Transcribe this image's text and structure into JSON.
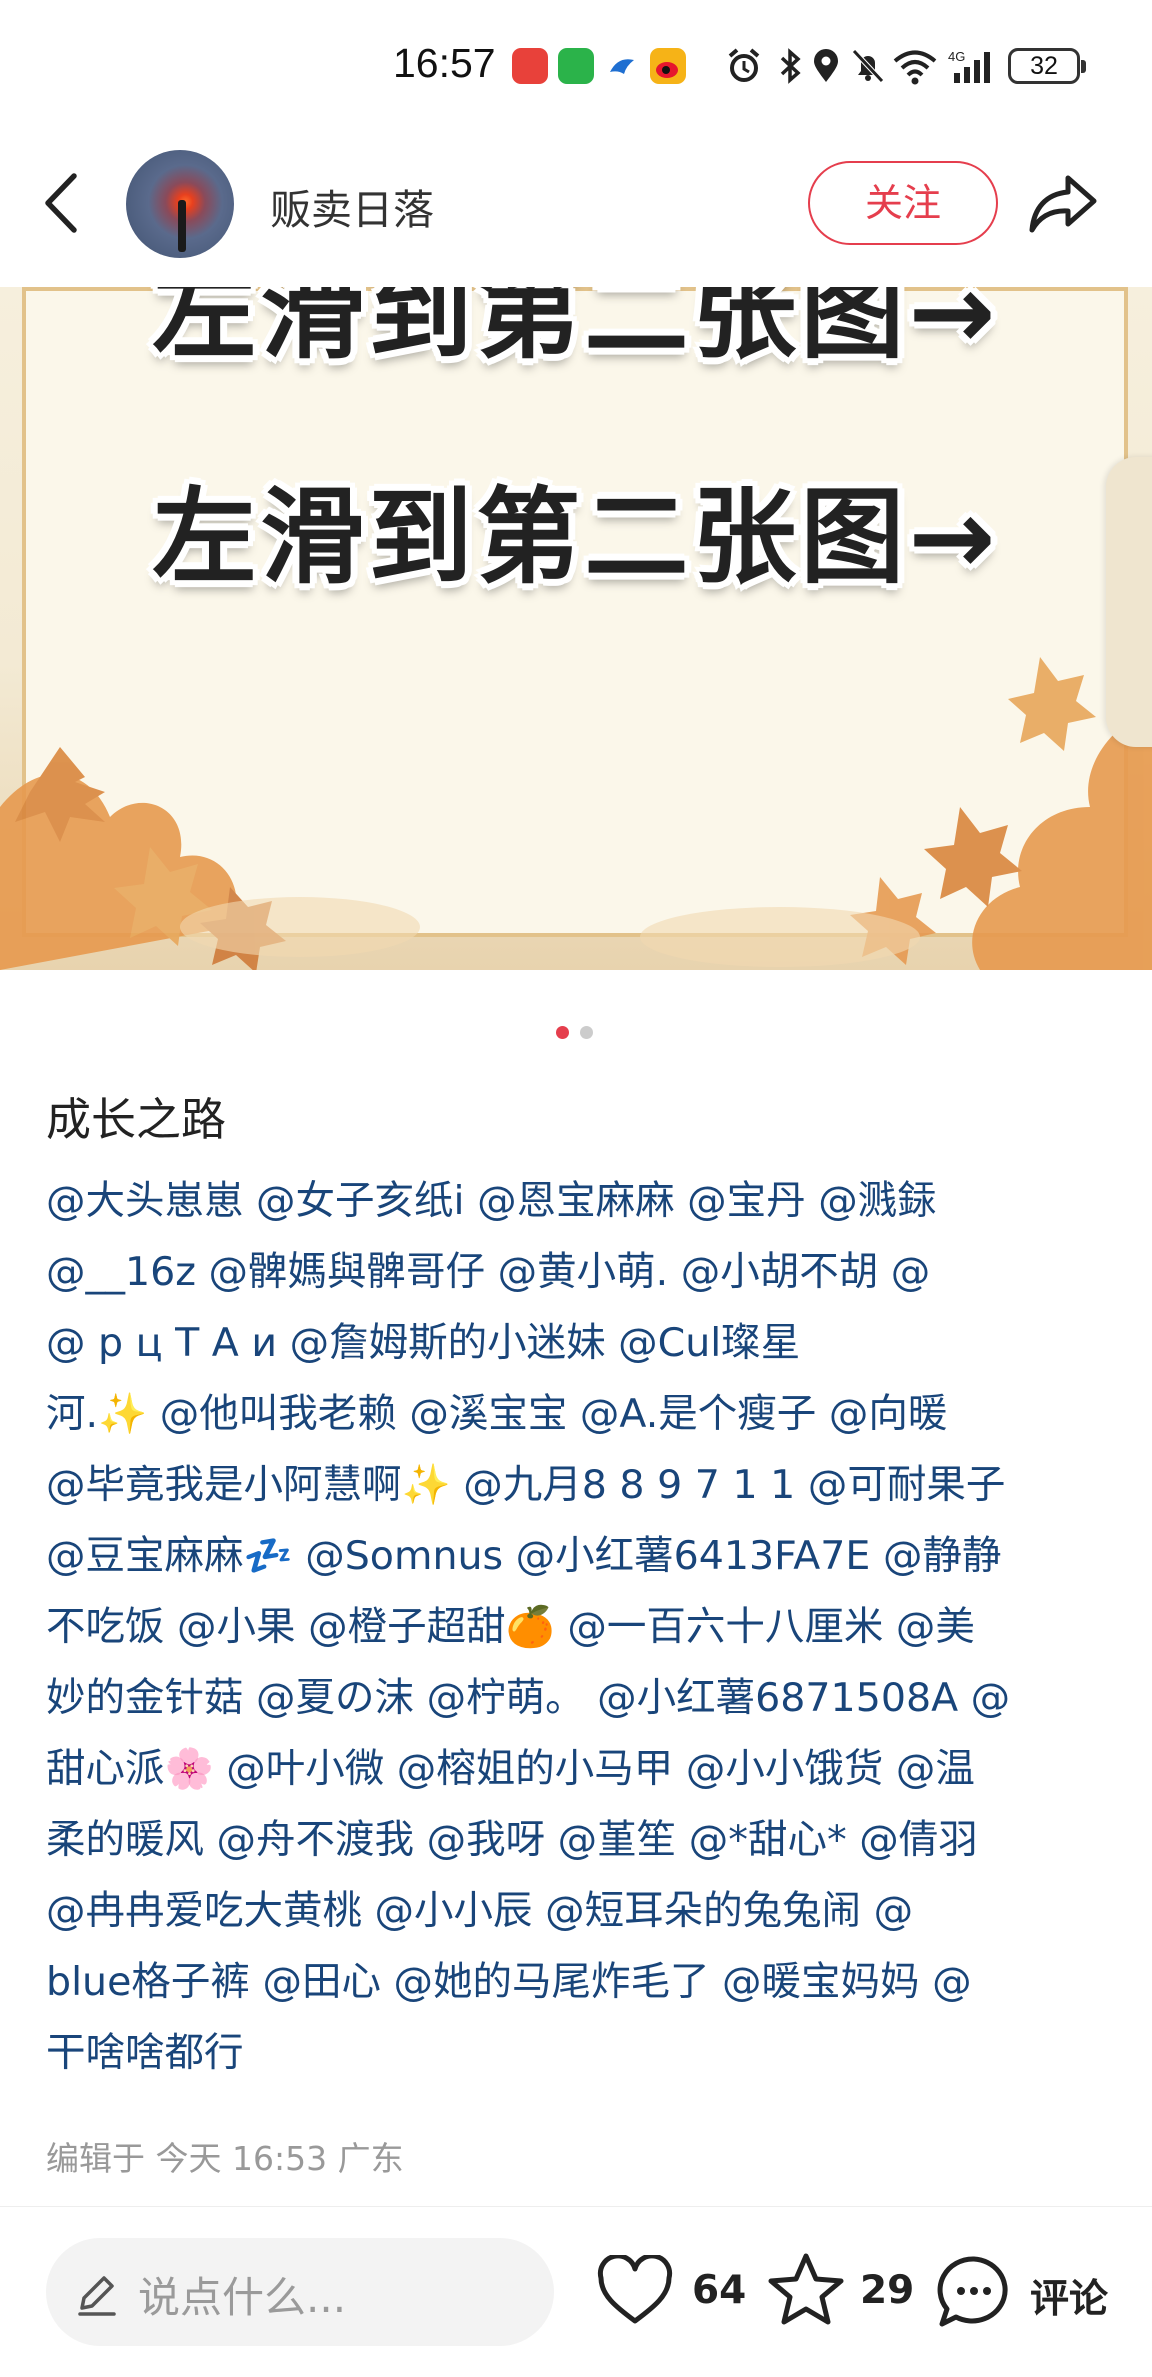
{
  "status_bar": {
    "time": "16:57",
    "battery": "32",
    "network": "4G"
  },
  "header": {
    "author_name": "贩卖日落",
    "follow_label": "关注"
  },
  "image": {
    "cover_text": "左滑到第二张图→",
    "current_page": 1,
    "total_pages": 2,
    "active_dot_color": "#e53e4d",
    "inactive_dot_color": "#cccccc"
  },
  "post": {
    "title": "成长之路",
    "body": "@大头崽崽 @女子亥纸i @恩宝麻麻 @宝丹 @溅銾\n@__16z @髀媽與髀哥仔 @黄小萌. @小胡不胡 @\n        @ p ц Т А и  @詹姆斯的小迷妹 @Cul璨星\n河.✨ @他叫我老赖 @溪宝宝 @A.是个瘦子 @向暖\n@毕竟我是小阿慧啊✨ @九月8 8 9 7 1 1 @可耐果子\n@豆宝麻麻💤 @Somnus @小红薯6413FA7E @静静\n不吃饭 @小果 @橙子超甜🍊 @一百六十八厘米 @美\n妙的金针菇 @夏の沫 @柠萌。 @小红薯6871508A @\n甜心派🌸 @叶小微 @榕姐的小马甲 @小小饿货 @温\n柔的暖风 @舟不渡我 @我呀 @堇笙 @*甜心* @倩羽\n@冉冉爱吃大黄桃 @小小辰 @短耳朵的兔兔闹 @\nblue格子裤 @田心 @她的马尾炸毛了 @暖宝妈妈 @\n干啥啥都行",
    "meta": "编辑于  今天 16:53  广东"
  },
  "bottom_bar": {
    "comment_placeholder": "说点什么...",
    "like_count": "64",
    "collect_count": "29",
    "comment_label": "评论"
  },
  "icons": {
    "back": "chevron-left-icon",
    "share": "share-arrow-icon",
    "like": "heart-icon",
    "collect": "star-icon",
    "comment": "chat-bubble-icon",
    "pencil": "pencil-icon"
  },
  "colors": {
    "accent": "#e53e4d",
    "mention": "#19457a"
  }
}
